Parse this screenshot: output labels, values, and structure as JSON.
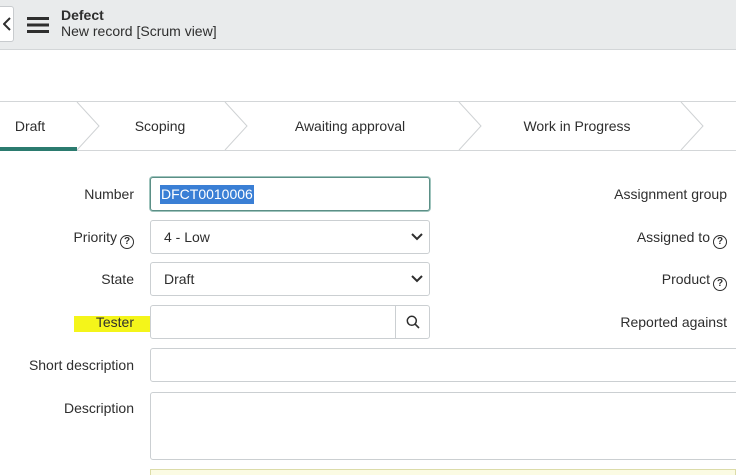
{
  "header": {
    "title": "Defect",
    "subtitle": "New record [Scrum view]"
  },
  "process_flow": {
    "steps": [
      {
        "label": "Draft",
        "active": true
      },
      {
        "label": "Scoping",
        "active": false
      },
      {
        "label": "Awaiting approval",
        "active": false
      },
      {
        "label": "Work in Progress",
        "active": false
      }
    ],
    "active_color": "#2b7b6f"
  },
  "form": {
    "number": {
      "label": "Number",
      "value": "DFCT0010006"
    },
    "priority": {
      "label": "Priority",
      "value": "4 - Low"
    },
    "state": {
      "label": "State",
      "value": "Draft"
    },
    "tester": {
      "label": "Tester",
      "value": ""
    },
    "short_description": {
      "label": "Short description",
      "value": ""
    },
    "description": {
      "label": "Description",
      "value": ""
    },
    "assignment_group": {
      "label": "Assignment group"
    },
    "assigned_to": {
      "label": "Assigned to"
    },
    "product": {
      "label": "Product"
    },
    "reported_against": {
      "label": "Reported against"
    }
  },
  "icons": {
    "back": "chevron-left-icon",
    "menu": "hamburger-menu-icon",
    "help": "question-circle-icon",
    "lookup": "search-icon",
    "dropdown": "chevron-down-icon"
  },
  "colors": {
    "header_bg": "#e9ebec",
    "selection": "#3a7fd5",
    "highlight": "#f4f51a"
  }
}
